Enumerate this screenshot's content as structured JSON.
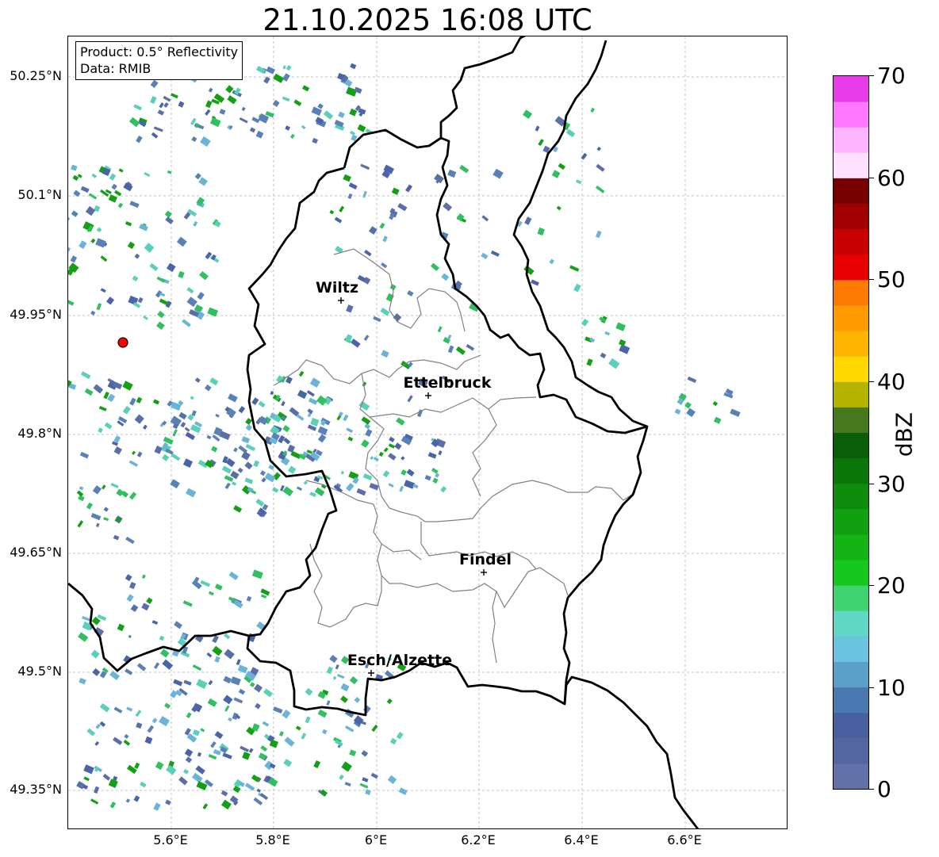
{
  "title": "21.10.2025 16:08 UTC",
  "info_box": {
    "product": "Product: 0.5° Reflectivity",
    "data_source": "Data: RMIB"
  },
  "latitude_labels": [
    "50.25°N",
    "50.1°N",
    "49.95°N",
    "49.8°N",
    "49.65°N",
    "49.5°N",
    "49.35°N"
  ],
  "longitude_labels": [
    "5.6°E",
    "5.8°E",
    "6°E",
    "6.2°E",
    "6.4°E",
    "6.6°E"
  ],
  "cities": [
    {
      "name": "Wiltz"
    },
    {
      "name": "Ettelbruck"
    },
    {
      "name": "Findel"
    },
    {
      "name": "Esch/Alzette"
    }
  ],
  "colorbar": {
    "label": "dBZ",
    "ticks": [
      "70",
      "60",
      "50",
      "40",
      "30",
      "20",
      "10",
      "0"
    ],
    "min": 0,
    "max": 70,
    "colors": [
      "#6272a8",
      "#5466a2",
      "#4a5fa0",
      "#4a78b0",
      "#5aa0c8",
      "#6ac4e0",
      "#62d6c4",
      "#40d470",
      "#14c81e",
      "#14b414",
      "#10a010",
      "#0e8c0e",
      "#0a760a",
      "#0a5e0a",
      "#46781e",
      "#b4b400",
      "#ffd800",
      "#ffb400",
      "#ff9a00",
      "#ff7a00",
      "#e60000",
      "#c80000",
      "#a00000",
      "#780000",
      "#ffe0ff",
      "#ffb4ff",
      "#ff78ff",
      "#e83ce8"
    ]
  },
  "radar_site": {
    "color": "#ff0000"
  },
  "grid": true
}
